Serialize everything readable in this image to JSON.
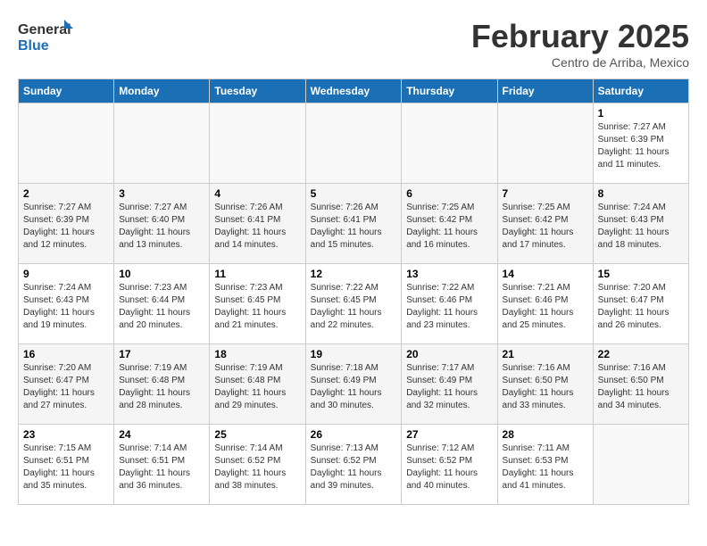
{
  "logo": {
    "general": "General",
    "blue": "Blue"
  },
  "title": "February 2025",
  "subtitle": "Centro de Arriba, Mexico",
  "days_of_week": [
    "Sunday",
    "Monday",
    "Tuesday",
    "Wednesday",
    "Thursday",
    "Friday",
    "Saturday"
  ],
  "weeks": [
    [
      {
        "day": "",
        "info": ""
      },
      {
        "day": "",
        "info": ""
      },
      {
        "day": "",
        "info": ""
      },
      {
        "day": "",
        "info": ""
      },
      {
        "day": "",
        "info": ""
      },
      {
        "day": "",
        "info": ""
      },
      {
        "day": "1",
        "info": "Sunrise: 7:27 AM\nSunset: 6:39 PM\nDaylight: 11 hours and 11 minutes."
      }
    ],
    [
      {
        "day": "2",
        "info": "Sunrise: 7:27 AM\nSunset: 6:39 PM\nDaylight: 11 hours and 12 minutes."
      },
      {
        "day": "3",
        "info": "Sunrise: 7:27 AM\nSunset: 6:40 PM\nDaylight: 11 hours and 13 minutes."
      },
      {
        "day": "4",
        "info": "Sunrise: 7:26 AM\nSunset: 6:41 PM\nDaylight: 11 hours and 14 minutes."
      },
      {
        "day": "5",
        "info": "Sunrise: 7:26 AM\nSunset: 6:41 PM\nDaylight: 11 hours and 15 minutes."
      },
      {
        "day": "6",
        "info": "Sunrise: 7:25 AM\nSunset: 6:42 PM\nDaylight: 11 hours and 16 minutes."
      },
      {
        "day": "7",
        "info": "Sunrise: 7:25 AM\nSunset: 6:42 PM\nDaylight: 11 hours and 17 minutes."
      },
      {
        "day": "8",
        "info": "Sunrise: 7:24 AM\nSunset: 6:43 PM\nDaylight: 11 hours and 18 minutes."
      }
    ],
    [
      {
        "day": "9",
        "info": "Sunrise: 7:24 AM\nSunset: 6:43 PM\nDaylight: 11 hours and 19 minutes."
      },
      {
        "day": "10",
        "info": "Sunrise: 7:23 AM\nSunset: 6:44 PM\nDaylight: 11 hours and 20 minutes."
      },
      {
        "day": "11",
        "info": "Sunrise: 7:23 AM\nSunset: 6:45 PM\nDaylight: 11 hours and 21 minutes."
      },
      {
        "day": "12",
        "info": "Sunrise: 7:22 AM\nSunset: 6:45 PM\nDaylight: 11 hours and 22 minutes."
      },
      {
        "day": "13",
        "info": "Sunrise: 7:22 AM\nSunset: 6:46 PM\nDaylight: 11 hours and 23 minutes."
      },
      {
        "day": "14",
        "info": "Sunrise: 7:21 AM\nSunset: 6:46 PM\nDaylight: 11 hours and 25 minutes."
      },
      {
        "day": "15",
        "info": "Sunrise: 7:20 AM\nSunset: 6:47 PM\nDaylight: 11 hours and 26 minutes."
      }
    ],
    [
      {
        "day": "16",
        "info": "Sunrise: 7:20 AM\nSunset: 6:47 PM\nDaylight: 11 hours and 27 minutes."
      },
      {
        "day": "17",
        "info": "Sunrise: 7:19 AM\nSunset: 6:48 PM\nDaylight: 11 hours and 28 minutes."
      },
      {
        "day": "18",
        "info": "Sunrise: 7:19 AM\nSunset: 6:48 PM\nDaylight: 11 hours and 29 minutes."
      },
      {
        "day": "19",
        "info": "Sunrise: 7:18 AM\nSunset: 6:49 PM\nDaylight: 11 hours and 30 minutes."
      },
      {
        "day": "20",
        "info": "Sunrise: 7:17 AM\nSunset: 6:49 PM\nDaylight: 11 hours and 32 minutes."
      },
      {
        "day": "21",
        "info": "Sunrise: 7:16 AM\nSunset: 6:50 PM\nDaylight: 11 hours and 33 minutes."
      },
      {
        "day": "22",
        "info": "Sunrise: 7:16 AM\nSunset: 6:50 PM\nDaylight: 11 hours and 34 minutes."
      }
    ],
    [
      {
        "day": "23",
        "info": "Sunrise: 7:15 AM\nSunset: 6:51 PM\nDaylight: 11 hours and 35 minutes."
      },
      {
        "day": "24",
        "info": "Sunrise: 7:14 AM\nSunset: 6:51 PM\nDaylight: 11 hours and 36 minutes."
      },
      {
        "day": "25",
        "info": "Sunrise: 7:14 AM\nSunset: 6:52 PM\nDaylight: 11 hours and 38 minutes."
      },
      {
        "day": "26",
        "info": "Sunrise: 7:13 AM\nSunset: 6:52 PM\nDaylight: 11 hours and 39 minutes."
      },
      {
        "day": "27",
        "info": "Sunrise: 7:12 AM\nSunset: 6:52 PM\nDaylight: 11 hours and 40 minutes."
      },
      {
        "day": "28",
        "info": "Sunrise: 7:11 AM\nSunset: 6:53 PM\nDaylight: 11 hours and 41 minutes."
      },
      {
        "day": "",
        "info": ""
      }
    ]
  ]
}
